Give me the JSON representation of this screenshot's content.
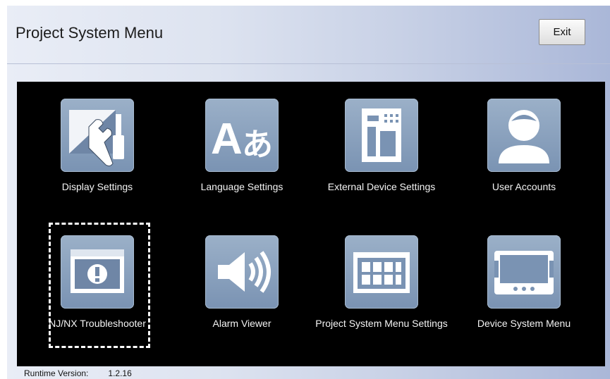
{
  "header": {
    "title": "Project System Menu",
    "exit_label": "Exit"
  },
  "tiles": [
    {
      "label": "Display Settings",
      "icon": "display-settings-icon"
    },
    {
      "label": "Language Settings",
      "icon": "language-icon"
    },
    {
      "label": "External Device Settings",
      "icon": "external-device-icon"
    },
    {
      "label": "User Accounts",
      "icon": "user-icon"
    },
    {
      "label": "NJ/NX Troubleshooter",
      "icon": "troubleshooter-icon"
    },
    {
      "label": "Alarm Viewer",
      "icon": "alarm-speaker-icon"
    },
    {
      "label": "Project System Menu Settings",
      "icon": "keypad-icon"
    },
    {
      "label": "Device System Menu",
      "icon": "device-icon"
    }
  ],
  "footer": {
    "runtime_label": "Runtime Version:",
    "runtime_version": "1.2.16"
  },
  "colors": {
    "panel_bg": "#000000",
    "tile_icon_bg": "#8aa1bf",
    "highlight_dash": "#ffffff"
  }
}
